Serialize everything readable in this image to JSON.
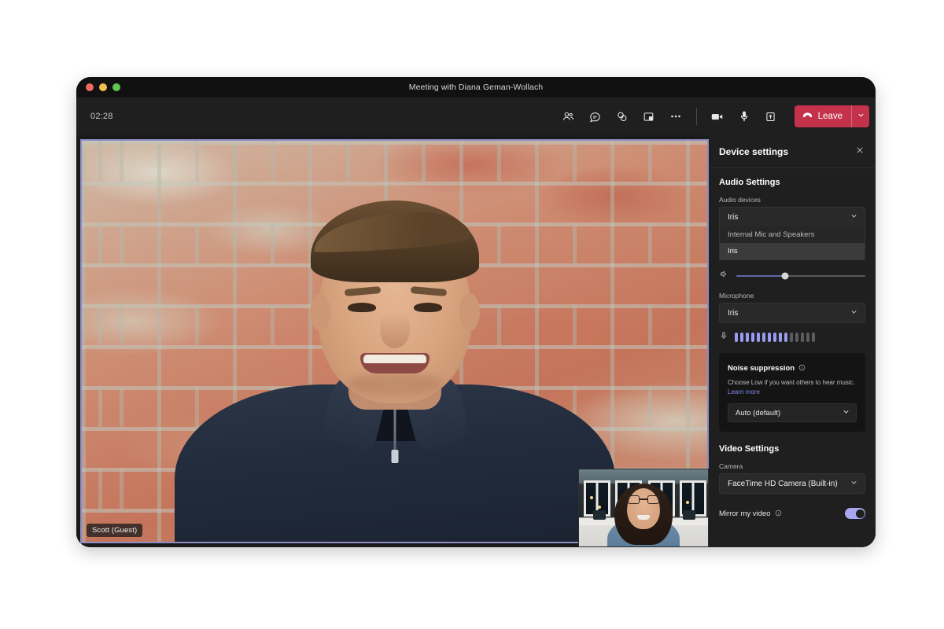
{
  "window": {
    "title": "Meeting with Diana Geman-Wollach",
    "traffic_lights": [
      "close",
      "minimize",
      "maximize"
    ]
  },
  "toolbar": {
    "timer": "02:28",
    "icons": [
      {
        "name": "people-icon",
        "label": "People"
      },
      {
        "name": "chat-icon",
        "label": "Chat"
      },
      {
        "name": "reactions-icon",
        "label": "Reactions"
      },
      {
        "name": "breakout-rooms-icon",
        "label": "Rooms"
      },
      {
        "name": "more-options-icon",
        "label": "More options"
      }
    ],
    "media_icons": [
      {
        "name": "camera-icon",
        "label": "Camera"
      },
      {
        "name": "microphone-icon",
        "label": "Microphone"
      },
      {
        "name": "share-icon",
        "label": "Share"
      }
    ],
    "leave_label": "Leave",
    "leave_color": "#c4314b"
  },
  "stage": {
    "active_speaker_name": "Scott (Guest)",
    "active_border_color": "#8b8cc7",
    "pip_participant": "Diana Geman-Wollach"
  },
  "panel": {
    "title": "Device settings",
    "close_label": "✕",
    "audio": {
      "section_title": "Audio Settings",
      "devices_label": "Audio devices",
      "devices_value": "Iris",
      "devices_options": [
        "Internal Mic and Speakers",
        "Iris"
      ],
      "devices_selected": "Iris",
      "volume_percent": 38,
      "microphone_label": "Microphone",
      "microphone_value": "Iris",
      "mic_level_active_bars": 10,
      "mic_level_total_bars": 15,
      "noise": {
        "title": "Noise suppression",
        "description": "Choose Low if you want others to hear music.",
        "link_label": "Learn more",
        "value": "Auto (default)"
      }
    },
    "video": {
      "section_title": "Video Settings",
      "camera_label": "Camera",
      "camera_value": "FaceTime HD Camera (Built-in)",
      "mirror_label": "Mirror my video",
      "mirror_on": true,
      "toggle_color": "#a6a7f0"
    }
  }
}
